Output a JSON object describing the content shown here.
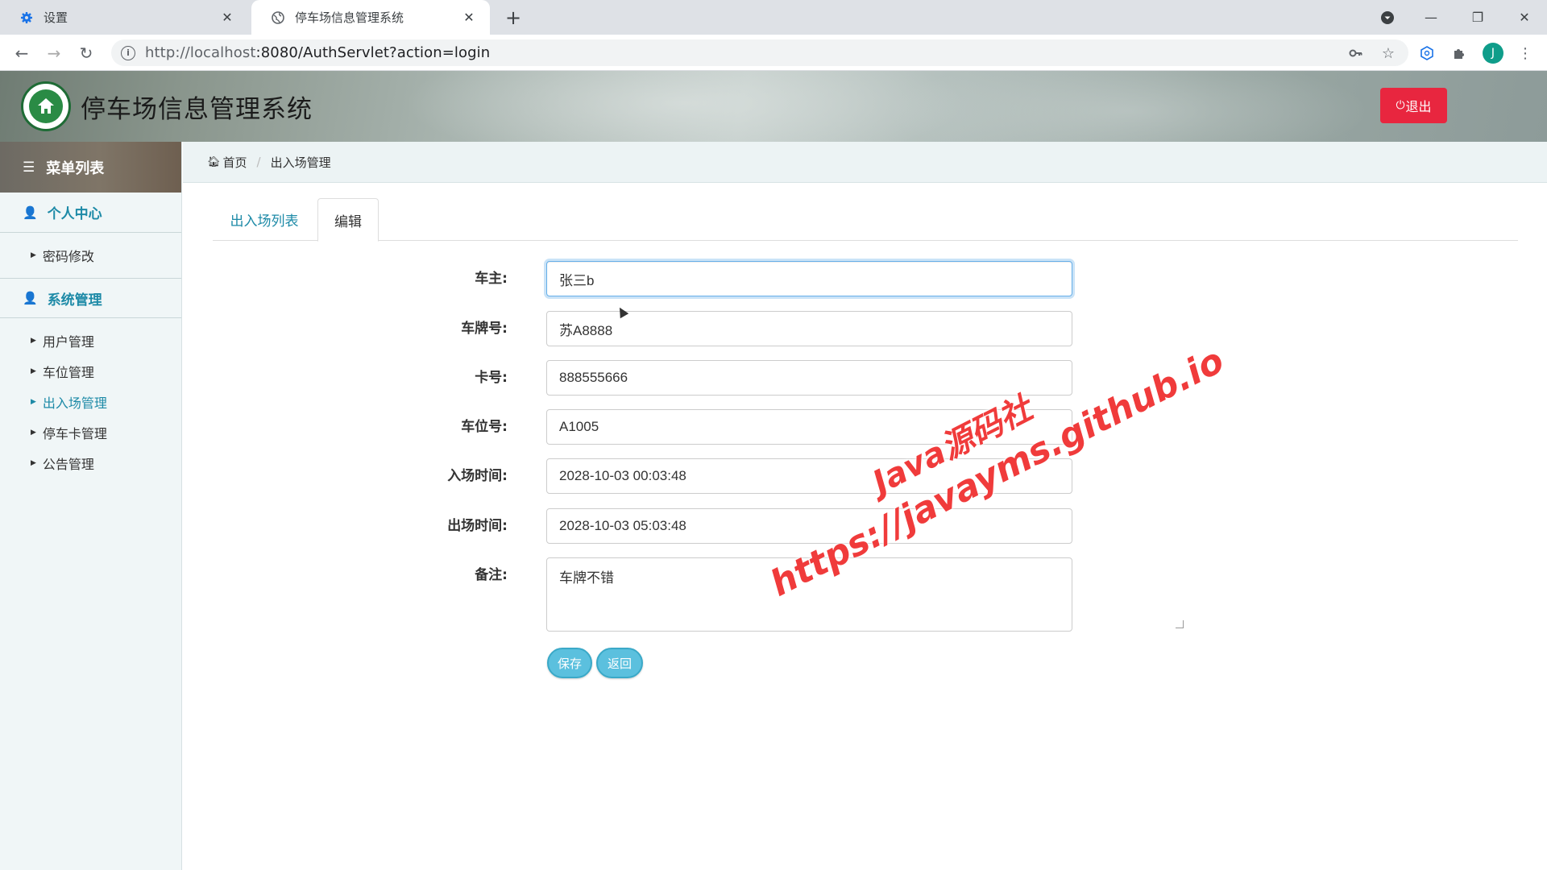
{
  "browser": {
    "tabs": [
      {
        "title": "设置",
        "icon": "gear-icon"
      },
      {
        "title": "停车场信息管理系统",
        "icon": "globe-icon"
      }
    ],
    "url_host": "http://localhost",
    "url_rest": ":8080/AuthServlet?action=login",
    "profile_initial": "J"
  },
  "header": {
    "title": "停车场信息管理系统",
    "logout_label": "退出"
  },
  "sidebar": {
    "menu_title": "菜单列表",
    "groups": [
      {
        "title": "个人中心",
        "items": [
          "密码修改"
        ]
      },
      {
        "title": "系统管理",
        "items": [
          "用户管理",
          "车位管理",
          "出入场管理",
          "停车卡管理",
          "公告管理"
        ]
      }
    ],
    "active_item": "出入场管理"
  },
  "breadcrumb": {
    "home": "首页",
    "current": "出入场管理"
  },
  "page_tabs": [
    "出入场列表",
    "编辑"
  ],
  "form": {
    "owner_label": "车主:",
    "owner_value": "张三b",
    "plate_label": "车牌号:",
    "plate_value": "苏A8888",
    "card_label": "卡号:",
    "card_value": "888555666",
    "space_label": "车位号:",
    "space_value": "A1005",
    "entry_label": "入场时间:",
    "entry_value": "2028-10-03 00:03:48",
    "exit_label": "出场时间:",
    "exit_value": "2028-10-03 05:03:48",
    "note_label": "备注:",
    "note_value": "车牌不错",
    "save_label": "保存",
    "back_label": "返回"
  },
  "watermark": {
    "line1": "Java源码社",
    "line2": "https://javayms.github.io"
  },
  "colors": {
    "accent": "#1d8aa7",
    "logout": "#e8263f",
    "button": "#5bc0de"
  }
}
